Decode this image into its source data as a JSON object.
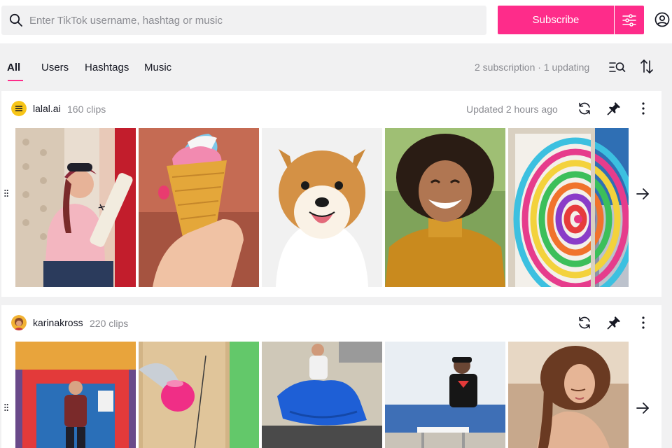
{
  "search": {
    "placeholder": "Enter TikTok username, hashtag or music"
  },
  "toolbar": {
    "subscribe_label": "Subscribe"
  },
  "tabs": [
    {
      "label": "All",
      "active": true
    },
    {
      "label": "Users",
      "active": false
    },
    {
      "label": "Hashtags",
      "active": false
    },
    {
      "label": "Music",
      "active": false
    }
  ],
  "subscription_status": "2 subscription · 1 updating",
  "accent_color": "#fe2c8a",
  "subscriptions": [
    {
      "username": "lalal.ai",
      "clips": "160 clips",
      "updated": "Updated 2 hours ago",
      "thumbnails": [
        "woman-with-cricket-bat",
        "hand-holding-ice-cream-cone",
        "smiling-shiba-inu-dog",
        "laughing-woman-curly-hair",
        "rainbow-painted-board"
      ]
    },
    {
      "username": "karinakross",
      "clips": "220 clips",
      "updated": "",
      "thumbnails": [
        "man-under-carnival-arch",
        "pink-ball-on-wooden-board",
        "man-with-blue-tarp",
        "man-at-white-table",
        "woman-with-long-hair"
      ]
    }
  ],
  "icons": {
    "search": "search-icon",
    "filter": "sliders-icon",
    "account": "user-circle-icon",
    "list_search": "list-search-icon",
    "sort": "sort-arrows-icon",
    "refresh": "refresh-icon",
    "pin": "pin-icon",
    "more": "more-vertical-icon",
    "next": "arrow-right-icon",
    "drag": "drag-handle-icon"
  }
}
